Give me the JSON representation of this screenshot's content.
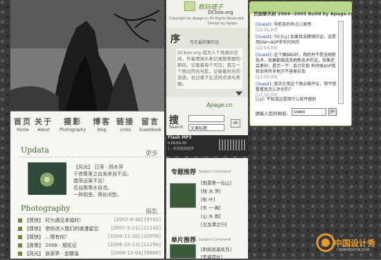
{
  "header": {
    "logo_cn": "数码理子",
    "logo_en": "DCbox.org",
    "copyright": "Copyright by Apage.cn All Rights Reserved.",
    "design": "Design by Apage."
  },
  "nav": {
    "items": [
      {
        "cn": "首页",
        "en": "Home"
      },
      {
        "cn": "关于",
        "en": "About"
      },
      {
        "cn": "摄影",
        "en": "Photography"
      },
      {
        "cn": "博客",
        "en": "blog"
      },
      {
        "cn": "链接",
        "en": "Links"
      },
      {
        "cn": "留言",
        "en": "Guestbook"
      }
    ]
  },
  "preface": {
    "title": "序",
    "subtitle": "写在最前面的话",
    "text": "DCbox.org 成为人个性展示空间，作者用镜头来记录那美丽的瞬间，记录着每个可见；那又一个用过的光与影，记录着时光的流逝，也记录下生活的点滴与美丽。"
  },
  "apage": "Apage.cn",
  "search": {
    "label_cn": "搜",
    "label_en": "Search",
    "input_value": "",
    "select_value": "文章标题",
    "go": "ok"
  },
  "flash": {
    "title": "Flash MP3",
    "time": "0:05/04:20",
    "song": "1 - 新鸳鸯蝴蝶梦"
  },
  "updata": {
    "title": "Updata",
    "more": "更多",
    "text": "【风光】 日落 · 残水萍\n于夜雾里之出发来自不远，\n霞落远离不远！\n花自飘零水自流。\n一种相思，两处闲愁。"
  },
  "photography": {
    "title": "Photography",
    "more": "摄影",
    "items": [
      {
        "tag": "【情侠】",
        "text": "时为遇见幸福时!",
        "date": "[2007-6-30]",
        "count": "[9702]"
      },
      {
        "tag": "【情侠】",
        "text": "带你进入我们的浪漫星空",
        "date": "[2007-5-21]",
        "count": "[11142]"
      },
      {
        "tag": "【情侠】",
        "text": "…情有何？",
        "date": "[2006-11-26]",
        "count": "[10076]"
      },
      {
        "tag": "【夜景】",
        "text": "2006 · 烟花记",
        "date": "[2006-10-23]",
        "count": "[11256]"
      },
      {
        "tag": "【风光】",
        "text": "张家界 · 金鞭溪",
        "date": "[2006-10-04]",
        "count": "[9868]"
      }
    ]
  },
  "topic": {
    "title": "专题推荐",
    "en": "Subject Commend",
    "items": [
      "[雨景第一仙山]",
      "[残 水 萍]",
      "[秋 叶]",
      "[天 一 阁]",
      "[山 水 画]",
      "[五龙潭之行]"
    ]
  },
  "single": {
    "title": "单片推荐",
    "en": "Subject Commend",
    "items": [
      "[刺知凯基凯岛]",
      "[荒城遗址]"
    ]
  },
  "guestbook": {
    "title": "页面聊天树  2004~2005 Build by Apage.cn",
    "messages": [
      {
        "user": "[Guest]",
        "text": "导航条的有点儿美感",
        "time": "[22:05:00]"
      },
      {
        "user": "[Guest]",
        "text": "TO:[cy] 如果我没猜错的话，这是用DW+ASP手写代码的",
        "time": "[22:04:00]"
      },
      {
        "user": "[Guest]",
        "text": "这个跟BBS好，用的并不是无刷新技术，如果勤做成无刷新技术的话，效果还会更好，提示一下：会刃实现 有时候ASP我就会有所多地方不容易实现",
        "time": "[22:00:00]"
      },
      {
        "user": "[Guest]",
        "text": "我正在用这个网业做评论，想不想看看我怎么评价的？",
        "time": "[22:00:00]"
      },
      {
        "user": "[cy]",
        "text": "不知道这是用什么软件做的",
        "time": ""
      }
    ],
    "name_label": "请输入您的网名:",
    "name_value": "Guest",
    "go": "go"
  },
  "brand": {
    "name": "中国设计秀",
    "url": "CNWEBSHOW.COM"
  }
}
